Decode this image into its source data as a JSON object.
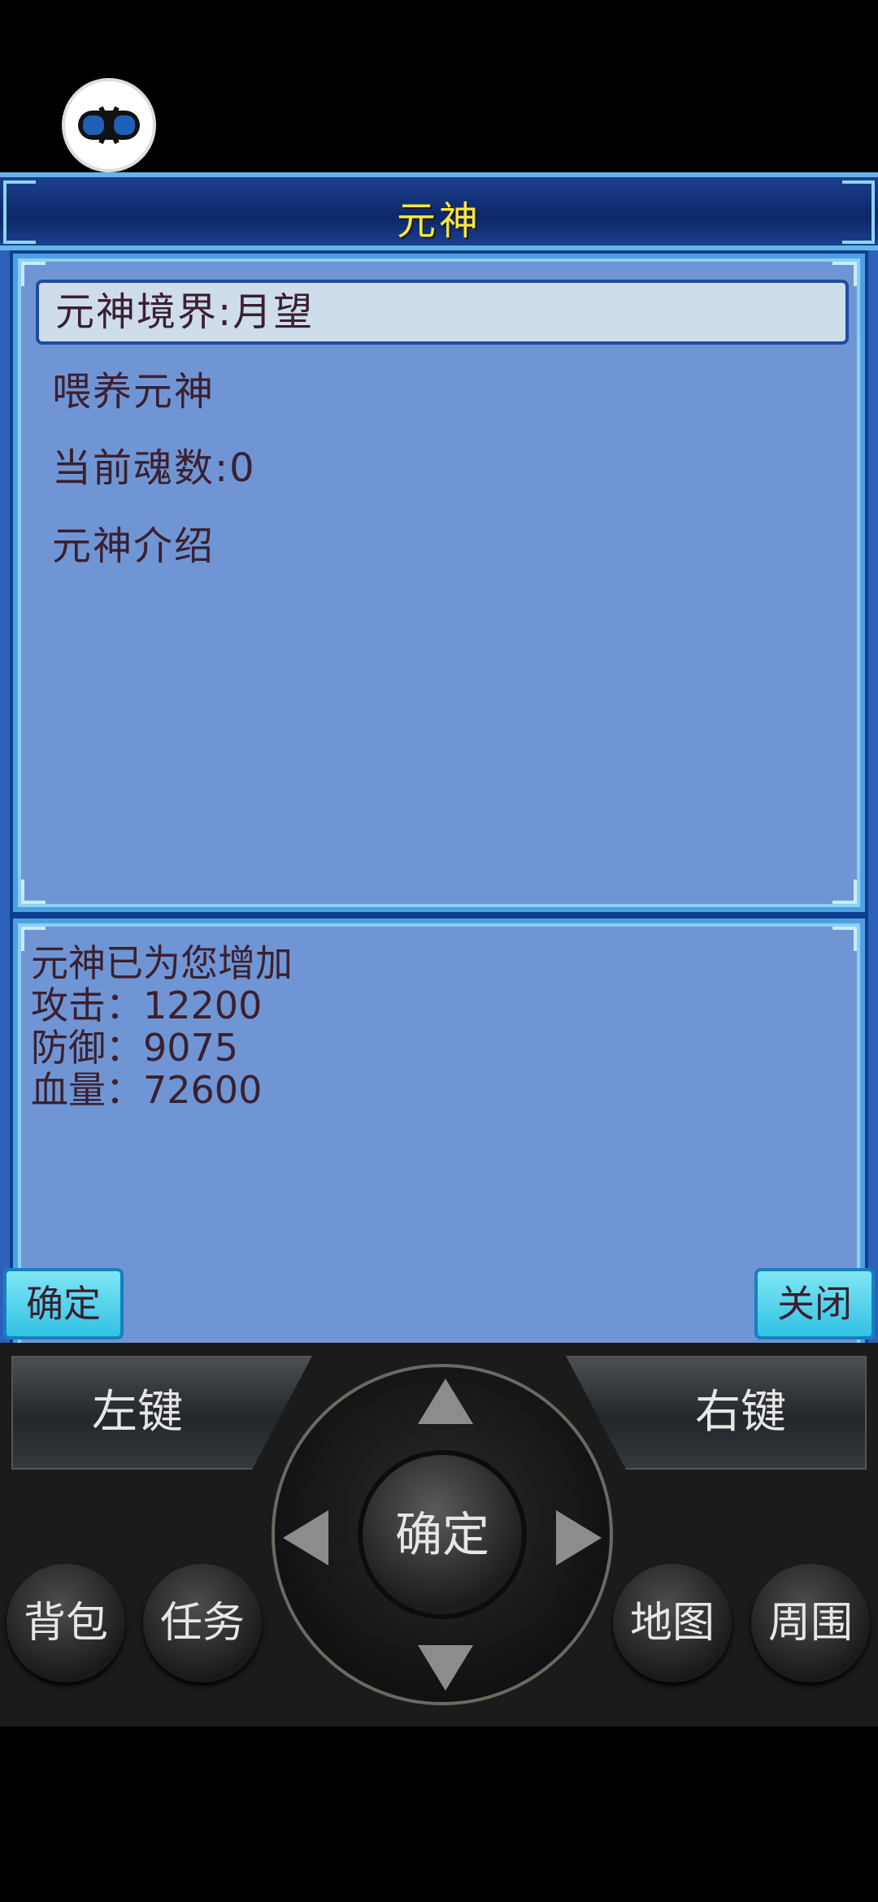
{
  "overlay": {
    "icon": "game-controller-icon"
  },
  "window": {
    "title": "元神"
  },
  "menu": {
    "items": [
      {
        "label": "元神境界:月望",
        "selected": true
      },
      {
        "label": "喂养元神",
        "selected": false
      },
      {
        "label": "当前魂数:0",
        "selected": false
      },
      {
        "label": "元神介绍",
        "selected": false
      }
    ]
  },
  "info": {
    "heading": "元神已为您增加",
    "lines": [
      "攻击：12200",
      "防御：9075",
      "血量：72600"
    ]
  },
  "dialog": {
    "confirm_label": "确定",
    "close_label": "关闭"
  },
  "keypad": {
    "left_soft": "左键",
    "right_soft": "右键",
    "center": "确定",
    "keys": [
      "背包",
      "任务",
      "地图",
      "周围"
    ]
  },
  "colors": {
    "title_text": "#f6e640",
    "panel_bg": "#7095d4",
    "panel_border": "#4fa0e0",
    "selection_bg": "#cfdcec",
    "button_bg": "#31c2e4"
  }
}
